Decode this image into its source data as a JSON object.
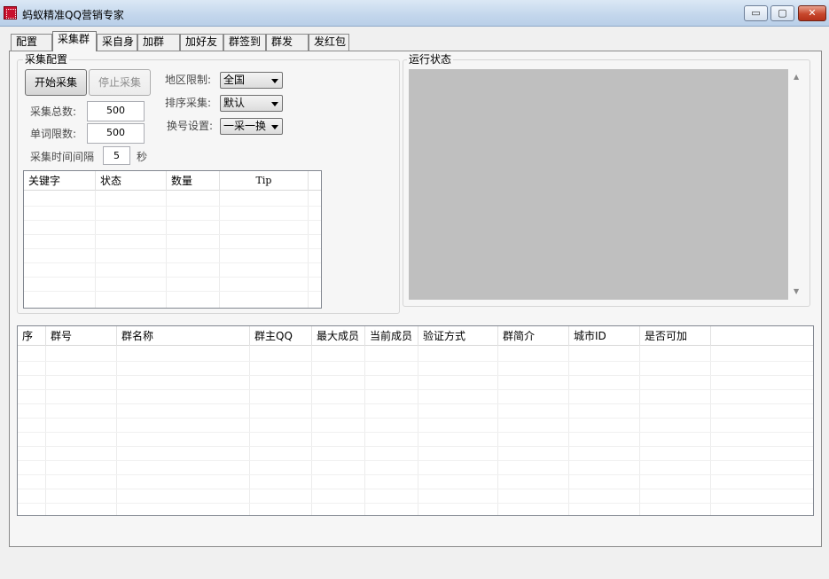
{
  "window": {
    "title": "蚂蚁精准QQ营销专家",
    "min_glyph": "▭",
    "max_glyph": "▢",
    "close_glyph": "✕"
  },
  "tabs": [
    {
      "label": "配置"
    },
    {
      "label": "采集群"
    },
    {
      "label": "采自身"
    },
    {
      "label": "加群"
    },
    {
      "label": "加好友"
    },
    {
      "label": "群签到"
    },
    {
      "label": "群发"
    },
    {
      "label": "发红包"
    }
  ],
  "active_tab": "采集群",
  "collect_config": {
    "title": "采集配置",
    "start_button": "开始采集",
    "stop_button": "停止采集",
    "total_label": "采集总数:",
    "total_value": "500",
    "per_word_label": "单词限数:",
    "per_word_value": "500",
    "interval_label": "采集时间间隔",
    "interval_value": "5",
    "interval_unit": "秒",
    "region_label": "地区限制:",
    "region_value": "全国",
    "sort_label": "排序采集:",
    "sort_value": "默认",
    "switch_label": "换号设置:",
    "switch_value": "一采一换"
  },
  "keyword_table": {
    "columns": [
      "关键字",
      "状态",
      "数量",
      "Tip"
    ],
    "rows": []
  },
  "run_status": {
    "title": "运行状态",
    "scroll_up": "▲",
    "scroll_down": "▼"
  },
  "group_table": {
    "columns": [
      "序",
      "群号",
      "群名称",
      "群主QQ",
      "最大成员",
      "当前成员",
      "验证方式",
      "群简介",
      "城市ID",
      "是否可加"
    ],
    "rows": []
  }
}
